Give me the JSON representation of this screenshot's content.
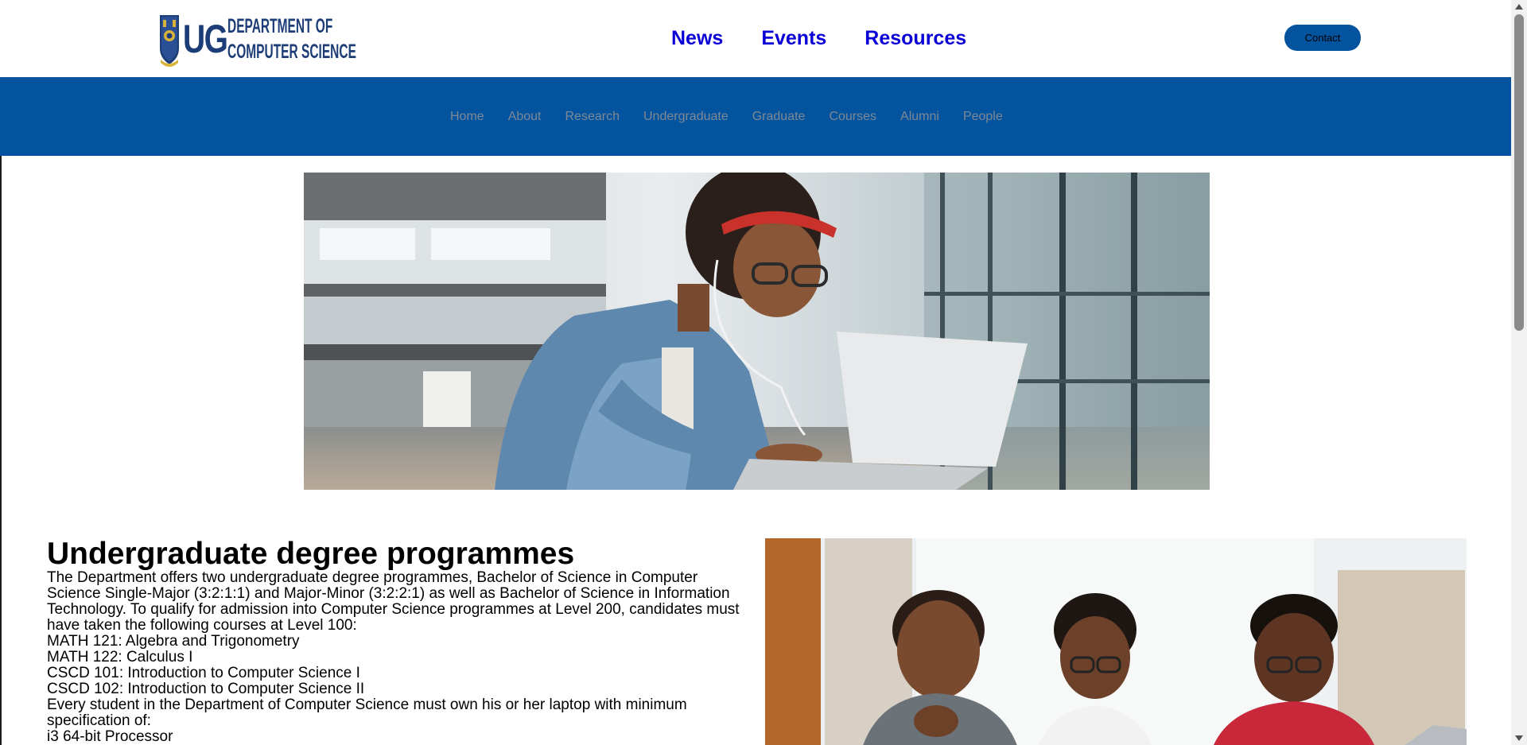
{
  "logo": {
    "mark": "UG",
    "line1": "DEPARTMENT OF",
    "line2": "COMPUTER SCIENCE"
  },
  "top_nav": {
    "news": "News",
    "events": "Events",
    "resources": "Resources"
  },
  "contact_label": "Contact",
  "main_nav": [
    "Home",
    "About",
    "Research",
    "Undergraduate",
    "Graduate",
    "Courses",
    "Alumni",
    "People"
  ],
  "programmes": {
    "heading": "Undergraduate degree programmes",
    "intro": "The Department offers two undergraduate degree programmes, Bachelor of Science in Computer Science Single-Major (3:2:1:1) and Major-Minor (3:2:2:1) as well as Bachelor of Science in Information Technology. To qualify for admission into Computer Science programmes at Level 200, candidates must have taken the following courses at Level 100:",
    "courses": [
      "MATH 121: Algebra and Trigonometry",
      "MATH 122: Calculus I",
      "CSCD 101: Introduction to Computer Science I",
      "CSCD 102: Introduction to Computer Science II"
    ],
    "laptop_note": "Every student in the Department of Computer Science must own his or her laptop with minimum specification of:",
    "spec_1": "i3 64-bit Processor"
  },
  "colors": {
    "brand_blue": "#03539f",
    "logo_blue": "#1d3d78",
    "top_nav_link": "#0a00d6",
    "main_nav_text": "#7e8995"
  }
}
